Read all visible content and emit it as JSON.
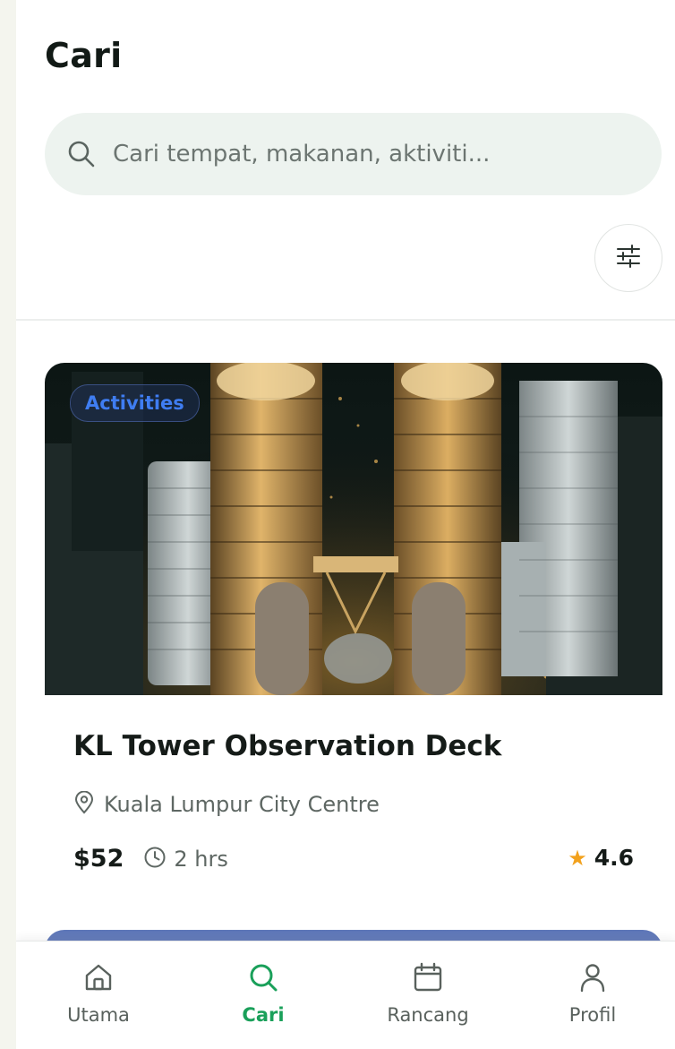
{
  "page": {
    "title": "Cari"
  },
  "search": {
    "placeholder": "Cari tempat, makanan, aktiviti...",
    "value": ""
  },
  "filter": {
    "icon": "sliders-icon"
  },
  "results": [
    {
      "category": "Activities",
      "title": "KL Tower Observation Deck",
      "location": "Kuala Lumpur City Centre",
      "price": "$52",
      "duration": "2 hrs",
      "rating": "4.6",
      "image": "petronas-towers-night-aerial"
    }
  ],
  "nav": {
    "items": [
      {
        "label": "Utama",
        "icon": "home-icon",
        "active": false
      },
      {
        "label": "Cari",
        "icon": "search-icon",
        "active": true
      },
      {
        "label": "Rancang",
        "icon": "calendar-icon",
        "active": false
      },
      {
        "label": "Profil",
        "icon": "user-icon",
        "active": false
      }
    ]
  },
  "colors": {
    "accent": "#1aa05a",
    "search_bg": "#edf3ef",
    "star": "#f2a11c",
    "chip_text": "#3f7df2"
  }
}
